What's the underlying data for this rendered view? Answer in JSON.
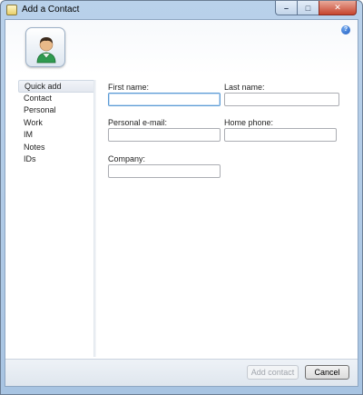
{
  "window": {
    "title": "Add a Contact",
    "controls": {
      "minimize": "–",
      "maximize": "□",
      "close": "✕"
    }
  },
  "header": {
    "avatar_icon": "contact-avatar-icon",
    "help_symbol": "?"
  },
  "nav": {
    "items": [
      {
        "label": "Quick add",
        "selected": true
      },
      {
        "label": "Contact"
      },
      {
        "label": "Personal"
      },
      {
        "label": "Work"
      },
      {
        "label": "IM"
      },
      {
        "label": "Notes"
      },
      {
        "label": "IDs"
      }
    ]
  },
  "form": {
    "first_name_label": "First name:",
    "first_name_value": "",
    "last_name_label": "Last name:",
    "last_name_value": "",
    "personal_email_label": "Personal e-mail:",
    "personal_email_value": "",
    "home_phone_label": "Home phone:",
    "home_phone_value": "",
    "company_label": "Company:",
    "company_value": ""
  },
  "footer": {
    "add_contact_label": "Add contact",
    "add_contact_enabled": false,
    "cancel_label": "Cancel"
  },
  "colors": {
    "frame": "#b9d1ea",
    "close_button": "#c6442d",
    "focus_border": "#5b9bd5",
    "disabled_text": "#a0a5ac"
  }
}
